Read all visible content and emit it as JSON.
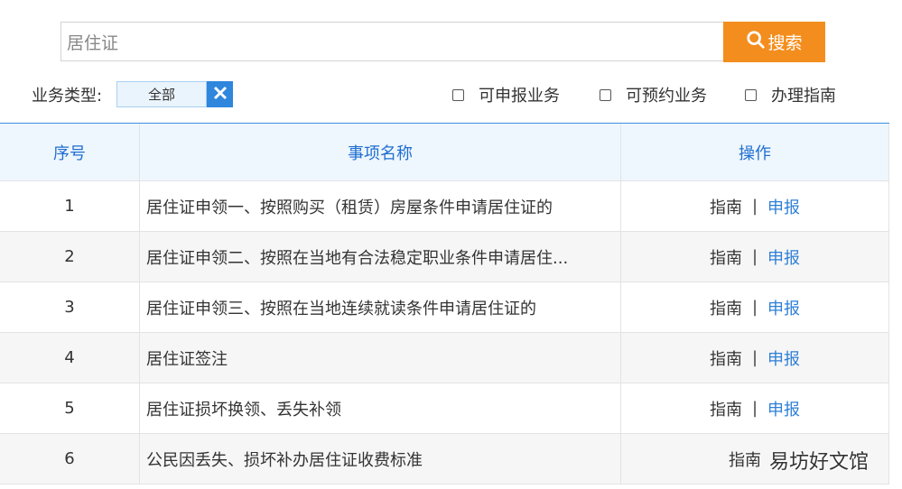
{
  "search": {
    "value": "居住证",
    "button_label": "搜索"
  },
  "filters": {
    "label": "业务类型:",
    "selected_chip": "全部",
    "checkboxes": [
      "可申报业务",
      "可预约业务",
      "办理指南"
    ]
  },
  "table": {
    "headers": [
      "序号",
      "事项名称",
      "操作"
    ],
    "rows": [
      {
        "no": "1",
        "name": "居住证申领一、按照购买（租赁）房屋条件申请居住证的",
        "guide": "指南",
        "sep": "|",
        "report": "申报"
      },
      {
        "no": "2",
        "name": "居住证申领二、按照在当地有合法稳定职业条件申请居住...",
        "guide": "指南",
        "sep": "|",
        "report": "申报"
      },
      {
        "no": "3",
        "name": "居住证申领三、按照在当地连续就读条件申请居住证的",
        "guide": "指南",
        "sep": "|",
        "report": "申报"
      },
      {
        "no": "4",
        "name": "居住证签注",
        "guide": "指南",
        "sep": "|",
        "report": "申报"
      },
      {
        "no": "5",
        "name": "居住证损坏换领、丢失补领",
        "guide": "指南",
        "sep": "|",
        "report": "申报"
      },
      {
        "no": "6",
        "name": "公民因丢失、损坏补办居住证收费标准",
        "guide": "指南",
        "sep": "",
        "report": ""
      }
    ]
  },
  "watermark": "易坊好文馆",
  "colors": {
    "accent": "#f38e1e",
    "primary": "#2e86dd",
    "header_text": "#1f6fd0",
    "header_bg": "#eef6fe"
  }
}
